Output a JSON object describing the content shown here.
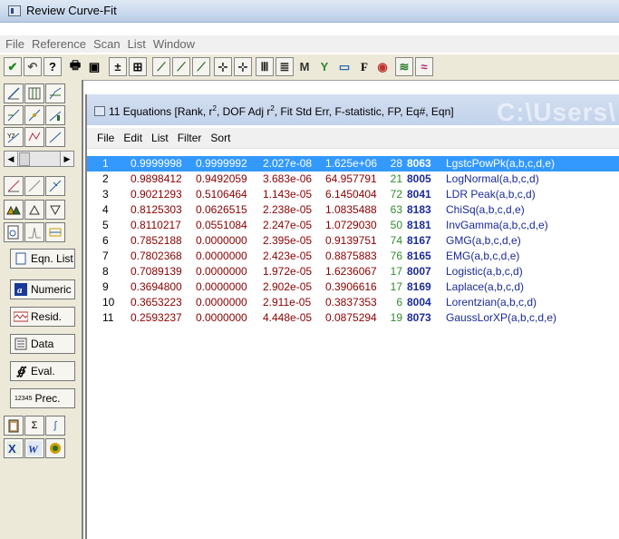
{
  "window": {
    "title": "Review Curve-Fit"
  },
  "menubar": [
    "File",
    "Reference",
    "Scan",
    "List",
    "Window"
  ],
  "toolbar": {
    "buttons": [
      {
        "name": "check-icon",
        "glyph": "✔"
      },
      {
        "name": "undo-icon",
        "glyph": "↶"
      },
      {
        "name": "help-icon",
        "glyph": "?"
      },
      {
        "name": "print-icon",
        "glyph": "🖶"
      },
      {
        "name": "copy-icon",
        "glyph": "▣"
      },
      {
        "name": "axis-plus-icon",
        "glyph": "±"
      },
      {
        "name": "grid-plus-icon",
        "glyph": "⊞"
      },
      {
        "name": "curve-icon-1",
        "glyph": "⟋"
      },
      {
        "name": "curve-icon-2",
        "glyph": "⟋"
      },
      {
        "name": "curve-icon-3",
        "glyph": "⟋"
      },
      {
        "name": "crosshair-icon",
        "glyph": "⊹"
      },
      {
        "name": "crosshair-range-icon",
        "glyph": "⊹"
      },
      {
        "name": "bars-icon",
        "glyph": "Ⅲ"
      },
      {
        "name": "list-icon",
        "glyph": "≣"
      },
      {
        "name": "binoculars-icon",
        "glyph": "M"
      },
      {
        "name": "fit-icon",
        "glyph": "Y"
      },
      {
        "name": "chart-icon",
        "glyph": "▭"
      },
      {
        "name": "font-icon",
        "glyph": "F"
      },
      {
        "name": "color-icon",
        "glyph": "◉"
      },
      {
        "name": "multi-curve-icon-1",
        "glyph": "≋"
      },
      {
        "name": "multi-curve-icon-2",
        "glyph": "≈"
      }
    ]
  },
  "sidebar": {
    "numeric": "Numeric",
    "resid": "Resid.",
    "data": "Data",
    "eval": "Eval.",
    "prec_icon": "12345",
    "prec": "Prec.",
    "eqn_list": "Eqn. List"
  },
  "child": {
    "title_main": "11 Equations  [Rank, r",
    "title_mid": ", DOF Adj r",
    "title_end": ", Fit Std Err, F-statistic, FP, Eq#, Eqn]",
    "sup": "2",
    "watermark": "C:\\Users\\",
    "menu": [
      "File",
      "Edit",
      "List",
      "Filter",
      "Sort"
    ]
  },
  "rows": [
    {
      "rank": "1",
      "r2": "0.9999998",
      "adj": "0.9999992",
      "err": "2.027e-08",
      "f": "1.625e+06",
      "fp": "28",
      "eq": "8063",
      "name": "LgstcPowPk(a,b,c,d,e)",
      "selected": true
    },
    {
      "rank": "2",
      "r2": "0.9898412",
      "adj": "0.9492059",
      "err": "3.683e-06",
      "f": "64.957791",
      "fp": "21",
      "eq": "8005",
      "name": "LogNormal(a,b,c,d)"
    },
    {
      "rank": "3",
      "r2": "0.9021293",
      "adj": "0.5106464",
      "err": "1.143e-05",
      "f": "6.1450404",
      "fp": "72",
      "eq": "8041",
      "name": "LDR Peak(a,b,c,d)"
    },
    {
      "rank": "4",
      "r2": "0.8125303",
      "adj": "0.0626515",
      "err": "2.238e-05",
      "f": "1.0835488",
      "fp": "63",
      "eq": "8183",
      "name": "ChiSq(a,b,c,d,e)"
    },
    {
      "rank": "5",
      "r2": "0.8110217",
      "adj": "0.0551084",
      "err": "2.247e-05",
      "f": "1.0729030",
      "fp": "50",
      "eq": "8181",
      "name": "InvGamma(a,b,c,d,e)"
    },
    {
      "rank": "6",
      "r2": "0.7852188",
      "adj": "0.0000000",
      "err": "2.395e-05",
      "f": "0.9139751",
      "fp": "74",
      "eq": "8167",
      "name": "GMG(a,b,c,d,e)"
    },
    {
      "rank": "7",
      "r2": "0.7802368",
      "adj": "0.0000000",
      "err": "2.423e-05",
      "f": "0.8875883",
      "fp": "76",
      "eq": "8165",
      "name": "EMG(a,b,c,d,e)"
    },
    {
      "rank": "8",
      "r2": "0.7089139",
      "adj": "0.0000000",
      "err": "1.972e-05",
      "f": "1.6236067",
      "fp": "17",
      "eq": "8007",
      "name": "Logistic(a,b,c,d)"
    },
    {
      "rank": "9",
      "r2": "0.3694800",
      "adj": "0.0000000",
      "err": "2.902e-05",
      "f": "0.3906616",
      "fp": "17",
      "eq": "8169",
      "name": "Laplace(a,b,c,d)"
    },
    {
      "rank": "10",
      "r2": "0.3653223",
      "adj": "0.0000000",
      "err": "2.911e-05",
      "f": "0.3837353",
      "fp": "6",
      "eq": "8004",
      "name": "Lorentzian(a,b,c,d)"
    },
    {
      "rank": "11",
      "r2": "0.2593237",
      "adj": "0.0000000",
      "err": "4.448e-05",
      "f": "0.0875294",
      "fp": "19",
      "eq": "8073",
      "name": "GaussLorXP(a,b,c,d,e)"
    }
  ],
  "colors": {
    "selection": "#3399ff",
    "stats": "#8b0000",
    "fp": "#2e8b2e",
    "equation": "#1a2a9a"
  }
}
